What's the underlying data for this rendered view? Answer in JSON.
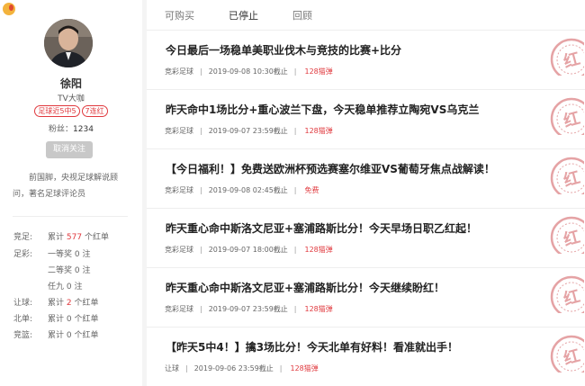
{
  "profile": {
    "name": "徐阳",
    "role": "TV大咖",
    "badges": [
      "足球近5中5",
      "7连红"
    ],
    "fans_label": "粉丝：",
    "fans_count": "1234",
    "unfollow_label": "取消关注",
    "bio": "前国脚，央视足球解说顾问，著名足球评论员"
  },
  "stats": [
    {
      "label": "竞足:",
      "prefix": "累计",
      "value": "577",
      "suffix": "个红单",
      "highlight": true
    },
    {
      "label": "足彩:",
      "prefix": "一等奖",
      "value": "0",
      "suffix": "注",
      "highlight": false
    },
    {
      "label": "",
      "prefix": "二等奖",
      "value": "0",
      "suffix": "注",
      "highlight": false
    },
    {
      "label": "",
      "prefix": "任九",
      "value": "0",
      "suffix": "注",
      "highlight": false
    },
    {
      "label": "让球:",
      "prefix": "累计",
      "value": "2",
      "suffix": "个红单",
      "highlight": true
    },
    {
      "label": "北单:",
      "prefix": "累计",
      "value": "0",
      "suffix": "个红单",
      "highlight": false
    },
    {
      "label": "竞篮:",
      "prefix": "累计",
      "value": "0",
      "suffix": "个红单",
      "highlight": false
    }
  ],
  "tabs": [
    "可购买",
    "已停止",
    "回顾"
  ],
  "active_tab": "已停止",
  "stamp_char": "红",
  "articles": [
    {
      "title": "今日最后一场稳单美职业伐木与竞技的比赛+比分",
      "category": "竞彩足球",
      "time": "2019-09-08 10:30截止",
      "price": "128猫弹"
    },
    {
      "title": "昨天命中1场比分+重心波兰下盘，今天稳单推荐立陶宛VS乌克兰",
      "category": "竞彩足球",
      "time": "2019-09-07 23:59截止",
      "price": "128猫弹"
    },
    {
      "title": "【今日福利！】免费送欧洲杯预选赛塞尔维亚VS葡萄牙焦点战解读！",
      "category": "竞彩足球",
      "time": "2019-09-08 02:45截止",
      "price": "免费"
    },
    {
      "title": "昨天重心命中斯洛文尼亚+塞浦路斯比分！今天早场日职乙红起！",
      "category": "竞彩足球",
      "time": "2019-09-07 18:00截止",
      "price": "128猫弹"
    },
    {
      "title": "昨天重心命中斯洛文尼亚+塞浦路斯比分！今天继续盼红！",
      "category": "竞彩足球",
      "time": "2019-09-07 23:59截止",
      "price": "128猫弹"
    },
    {
      "title": "【昨天5中4！】擒3场比分！今天北单有好料！看准就出手！",
      "category": "让球",
      "time": "2019-09-06 23:59截止",
      "price": "128猫弹"
    }
  ],
  "colors": {
    "accent": "#e0393e",
    "stamp": "#e5a3a5",
    "logo": "#f3b33d"
  }
}
